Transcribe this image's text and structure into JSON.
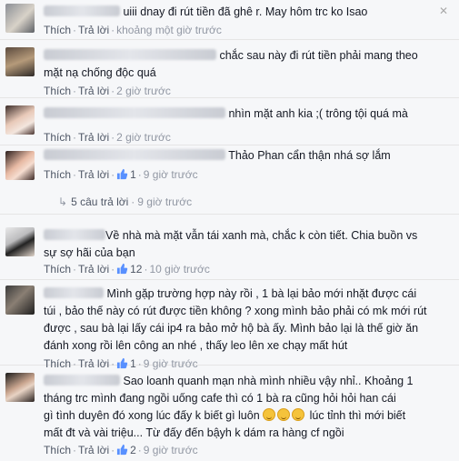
{
  "actions": {
    "like": "Thích",
    "reply": "Trả lời",
    "separator": "·"
  },
  "comments": [
    {
      "text": "uiii dnay đi rút tiền đã ghê r. May hôm trc ko Isao",
      "time": "khoảng một giờ trước",
      "likes": "",
      "avatar_icon": "profile-photo"
    },
    {
      "text_line1": "chắc sau này đi rút tiền phải mang theo",
      "text_line2": "mặt nạ chống độc quá",
      "time": "2 giờ trước",
      "likes": "",
      "avatar_icon": "profile-photo"
    },
    {
      "text": "nhìn mặt anh kia ;( trông tội quá mà",
      "time": "2 giờ trước",
      "likes": "",
      "avatar_icon": "profile-photo"
    },
    {
      "text": "Thảo Phan cẩn thận nhá sợ lắm",
      "time": "9 giờ trước",
      "likes": "1",
      "replies_text": "5 câu trả lời",
      "replies_time": "9 giờ trước",
      "avatar_icon": "profile-photo"
    },
    {
      "text_line1": "Về nhà mà mặt vẫn tái xanh mà, chắc k còn tiết. Chia buồn vs",
      "text_line2": "sự sợ hãi của bạn",
      "time": "10 giờ trước",
      "likes": "12",
      "avatar_icon": "profile-photo"
    },
    {
      "text_line1": "Mình gặp trường hợp này rồi , 1 bà lại bảo mới nhặt được cái",
      "text_line2": "túi , bảo thế này có rút được tiền không ? xong mình bảo phải có mk mới rút",
      "text_line3": "được , sau bà lại lấy cái ip4 ra bảo mở hộ bà ấy. Mình bảo lại là thế giờ ăn",
      "text_line4": "đánh xong rồi lên công an nhé , thấy leo lên xe chạy mất hút",
      "time": "9 giờ trước",
      "likes": "1",
      "avatar_icon": "profile-photo"
    },
    {
      "text_line1": "Sao loanh quanh mạn nhà mình nhiều vậy nhỉ.. Khoảng 1",
      "text_line2": "tháng trc mình đang ngồi uống cafe thì có 1 bà ra cũng hỏi hỏi han cái",
      "text_line3a": "gì tình duyên đó xong lúc đấy k biết gì luôn",
      "text_line3b": "lúc tỉnh thì mới biết",
      "text_line4": "mất đt và vài triệu... Từ đấy đến bậyh k dám ra hàng cf ngồi",
      "time": "9 giờ trước",
      "likes": "2",
      "avatar_icon": "profile-photo"
    }
  ],
  "colors": {
    "link": "#4e5665",
    "meta": "#9197a3",
    "like_blue": "#5890ff"
  }
}
